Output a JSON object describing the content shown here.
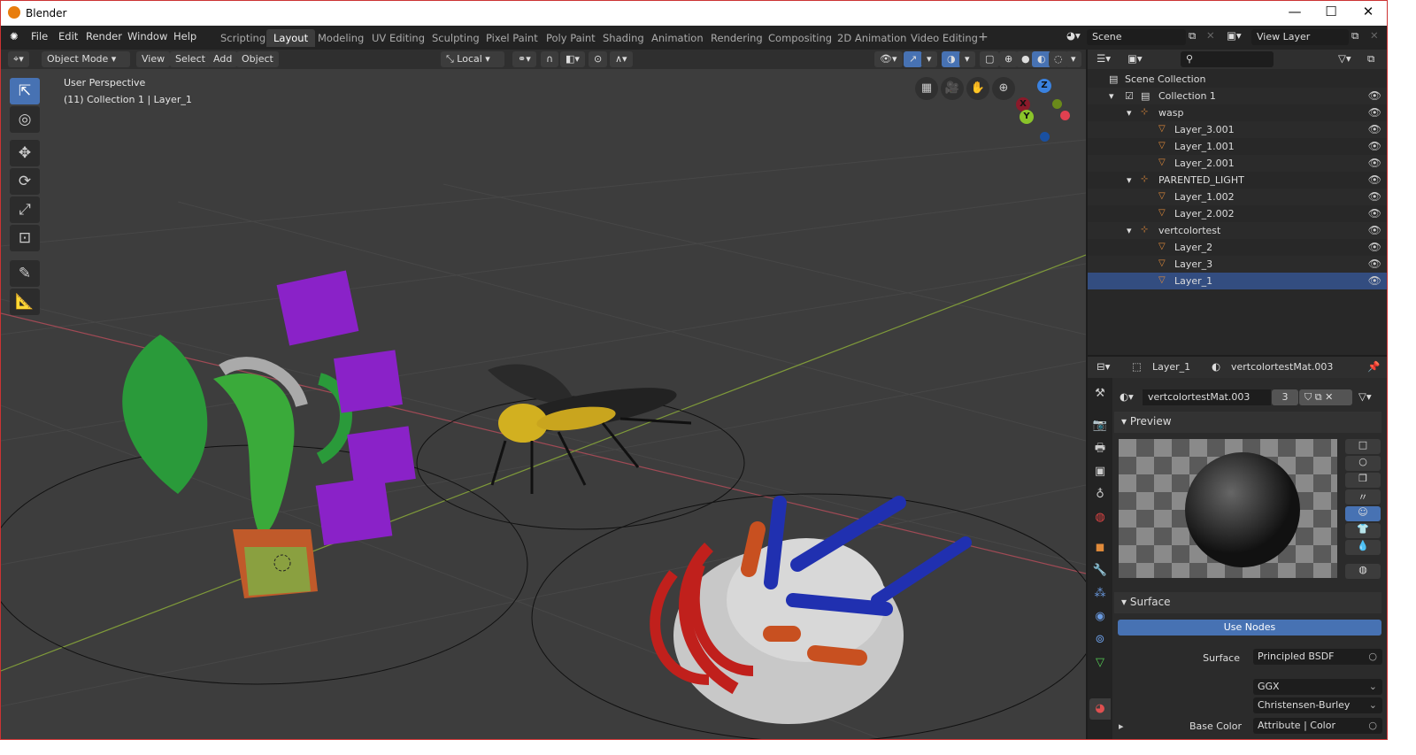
{
  "app": {
    "title": "Blender",
    "accent": "#4772b3"
  },
  "menus": [
    "File",
    "Edit",
    "Render",
    "Window",
    "Help"
  ],
  "workspaces": [
    "Scripting",
    "Layout",
    "Modeling",
    "UV Editing",
    "Sculpting",
    "Pixel Paint",
    "Poly Paint",
    "Shading",
    "Animation",
    "Rendering",
    "Compositing",
    "2D Animation",
    "Video Editing"
  ],
  "active_workspace": "Layout",
  "add_workspace": "+",
  "scene": {
    "scene_name": "Scene",
    "view_layer": "View Layer"
  },
  "viewport_header": {
    "mode": "Object Mode",
    "menus": [
      "View",
      "Select",
      "Add",
      "Object"
    ],
    "orientation": "Local"
  },
  "viewport": {
    "perspective": "User Perspective",
    "info": "(11) Collection 1 | Layer_1",
    "axes": {
      "x": "X",
      "y": "Y",
      "z": "Z"
    }
  },
  "outliner": {
    "root": "Scene Collection",
    "rows": [
      {
        "label": "Collection 1",
        "type": "collection"
      },
      {
        "label": "wasp",
        "type": "empty"
      },
      {
        "label": "Layer_3.001",
        "type": "mesh"
      },
      {
        "label": "Layer_1.001",
        "type": "mesh"
      },
      {
        "label": "Layer_2.001",
        "type": "mesh"
      },
      {
        "label": "PARENTED_LIGHT",
        "type": "empty"
      },
      {
        "label": "Layer_1.002",
        "type": "mesh"
      },
      {
        "label": "Layer_2.002",
        "type": "mesh"
      },
      {
        "label": "vertcolortest",
        "type": "empty"
      },
      {
        "label": "Layer_2",
        "type": "mesh"
      },
      {
        "label": "Layer_3",
        "type": "mesh"
      },
      {
        "label": "Layer_1",
        "type": "mesh",
        "selected": true
      }
    ]
  },
  "properties": {
    "object": "Layer_1",
    "material": "vertcolortestMat.003",
    "material_field": "vertcolortestMat.003",
    "users": "3",
    "preview_label": "Preview",
    "surface_label": "Surface",
    "use_nodes": "Use Nodes",
    "surface_field_label": "Surface",
    "surface_value": "Principled BSDF",
    "distribution": "GGX",
    "subsurface": "Christensen-Burley",
    "base_color_label": "Base Color",
    "base_color_value": "Attribute | Color"
  }
}
